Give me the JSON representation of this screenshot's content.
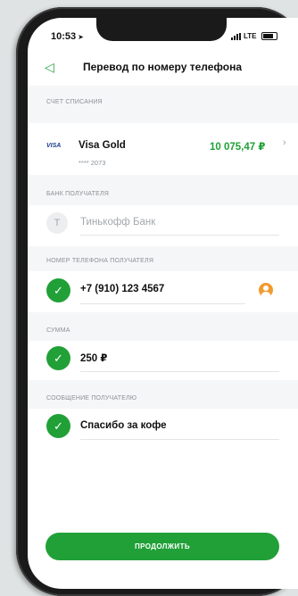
{
  "status_bar": {
    "time": "10:53",
    "carrier": "LTE"
  },
  "header": {
    "title": "Перевод по номеру телефона"
  },
  "account": {
    "section_label": "Счет списания",
    "card_brand": "VISA",
    "card_name": "Visa Gold",
    "card_number": "**** 2073",
    "balance": "10 075,47 ₽"
  },
  "bank": {
    "section_label": "Банк получателя",
    "letter": "Т",
    "name": "Тинькофф Банк"
  },
  "phone": {
    "section_label": "Номер телефона получателя",
    "value": "+7 (910) 123 4567"
  },
  "amount": {
    "section_label": "Сумма",
    "value": "250 ₽"
  },
  "message": {
    "section_label": "Сообщение получателю",
    "value": "Спасибо за кофе"
  },
  "actions": {
    "continue_label": "Продолжить"
  },
  "colors": {
    "accent": "#21a038",
    "contact_icon": "#f29a2e",
    "card_brand": "#1a3d8f"
  }
}
